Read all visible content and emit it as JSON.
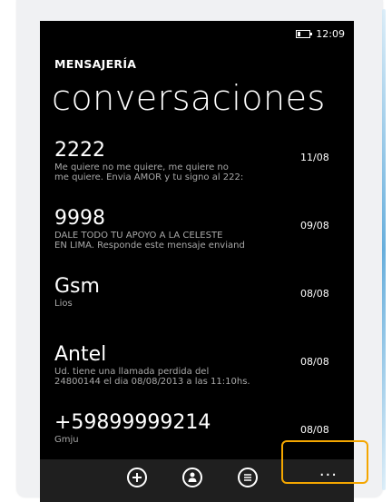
{
  "status": {
    "time": "12:09",
    "icons": [
      "battery-icon"
    ]
  },
  "header": {
    "app_title": "MENSAJERÍA",
    "pivot_title": "conversaciones"
  },
  "conversations": [
    {
      "name": "2222",
      "preview": "Me quiere no me quiere, me quiere no\nme quiere. Envia AMOR y tu signo al 222:",
      "date": "11/08"
    },
    {
      "name": "9998",
      "preview": "DALE TODO TU APOYO A LA CELESTE\nEN LIMA. Responde este mensaje enviand",
      "date": "09/08"
    },
    {
      "name": "Gsm",
      "preview": "Lios",
      "date": "08/08"
    },
    {
      "name": "Antel",
      "preview": "Ud. tiene una llamada perdida del\n24800144 el dia 08/08/2013 a las 11:10hs.",
      "date": "08/08"
    },
    {
      "name": "+59899999214",
      "preview": "Gmju",
      "date": "08/08"
    }
  ],
  "appbar": {
    "buttons": [
      "add-icon",
      "contact-icon",
      "select-list-icon"
    ],
    "more": "..."
  },
  "colors": {
    "background": "#000000",
    "appbar": "#1f1f1f",
    "highlight": "#f4a600",
    "text": "#ffffff",
    "muted": "#a8a8a8"
  }
}
